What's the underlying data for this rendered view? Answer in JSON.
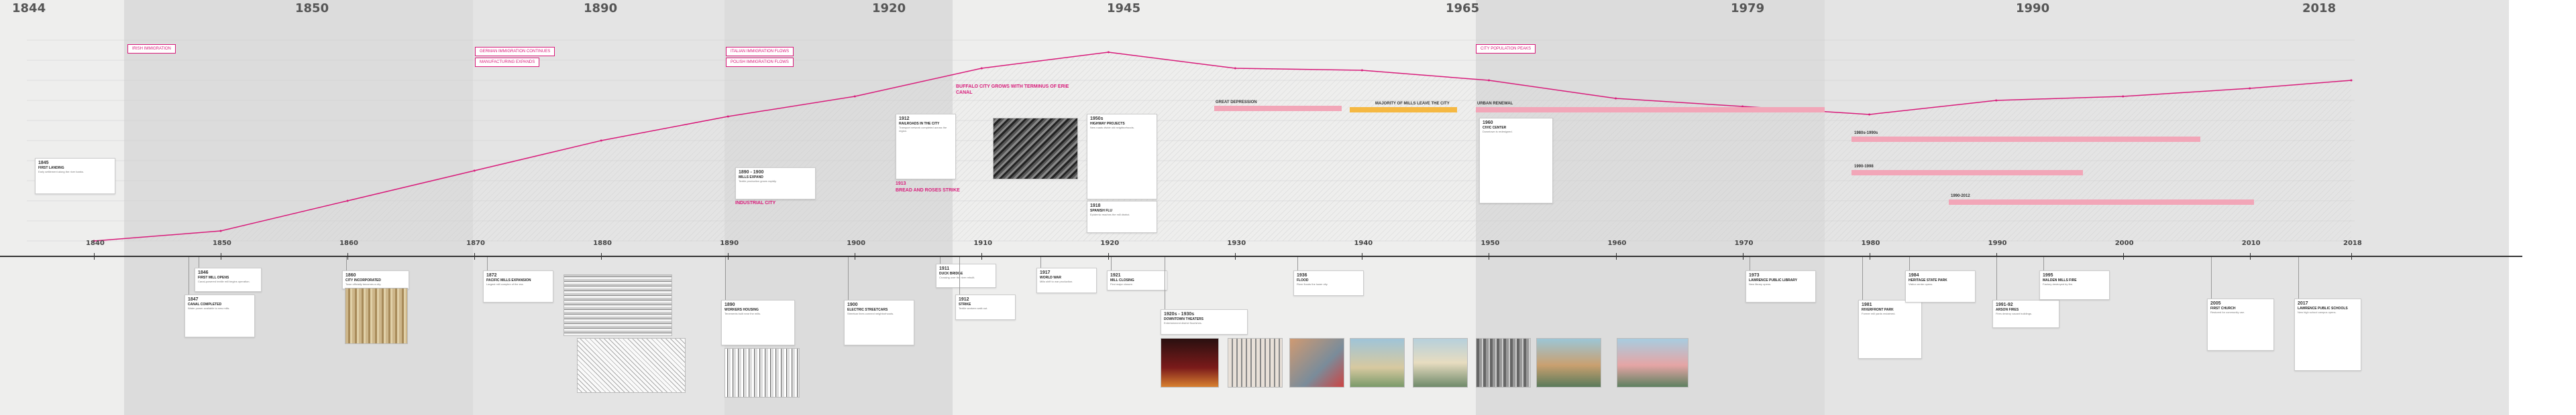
{
  "top_years": [
    "1844",
    "1850",
    "1890",
    "1920",
    "1945",
    "1965",
    "1979",
    "1990",
    "2018"
  ],
  "axis_ticks": [
    "1840",
    "1850",
    "1860",
    "1870",
    "1880",
    "1890",
    "1900",
    "1910",
    "1920",
    "1930",
    "1940",
    "1950",
    "1960",
    "1970",
    "1980",
    "1990",
    "2000",
    "2010",
    "2018"
  ],
  "pink_tags": [
    "IRISH IMMIGRATION",
    "GERMAN IMMIGRATION CONTINUES",
    "MANUFACTURING EXPANDS",
    "ITALIAN IMMIGRATION FLOWS",
    "POLISH IMMIGRATION FLOWS",
    "CITY POPULATION PEAKS",
    "FACTORIES CLOSING"
  ],
  "pink_texts": [
    "BUFFALO CITY GROWS WITH TERMINUS OF ERIE CANAL",
    "BUFFALO BECOMES GREAT INDUSTRIAL CITY",
    "1913",
    "BREAD AND ROSES STRIKE"
  ],
  "bars": [
    {
      "label": "GREAT DEPRESSION",
      "color": "#f2a6b8"
    },
    {
      "label": "MAJORITY OF MILLS LEAVE THE CITY",
      "color": "#f5b842"
    },
    {
      "label": "URBAN RENEWAL",
      "color": "#f2a6b8"
    },
    {
      "label": "1980s-1990s",
      "color": "#f2a6b8"
    },
    {
      "label": "1990-1998",
      "color": "#f2a6b8"
    },
    {
      "label": "1990-2012",
      "color": "#f2a6b8"
    }
  ],
  "upper_cards": [
    {
      "yr": "1845",
      "ttl": "FIRST LANDING",
      "body": "Early settlement along the river banks."
    },
    {
      "yr": "1890 - 1900",
      "ttl": "MILLS EXPAND",
      "body": "Textile production grows rapidly."
    },
    {
      "yr": "1912",
      "ttl": "RAILROADS IN THE CITY",
      "body": "Transport network completed across the region."
    },
    {
      "yr": "1918",
      "ttl": "SPANISH FLU",
      "body": "Epidemic reaches the mill district."
    },
    {
      "yr": "1950s",
      "ttl": "HIGHWAY PROJECTS",
      "body": "New roads divide old neighborhoods."
    },
    {
      "yr": "1960",
      "ttl": "CIVIC CENTER",
      "body": "Downtown is redesigned."
    }
  ],
  "lower_cards": [
    {
      "yr": "1846",
      "ttl": "FIRST MILL OPENS",
      "body": "Canal-powered textile mill begins operation."
    },
    {
      "yr": "1847",
      "ttl": "CANAL COMPLETED",
      "body": "Water power available to new mills."
    },
    {
      "yr": "1860",
      "ttl": "CITY INCORPORATED",
      "body": "Town officially becomes a city."
    },
    {
      "yr": "1872",
      "ttl": "PACIFIC MILLS EXPANSION",
      "body": "Largest mill complex of the era."
    },
    {
      "yr": "1890",
      "ttl": "WORKERS HOUSING",
      "body": "Tenements built near the mills."
    },
    {
      "yr": "1900",
      "ttl": "ELECTRIC STREETCARS",
      "body": "Streetcar lines connect neighborhoods."
    },
    {
      "yr": "1911",
      "ttl": "DUCK BRIDGE",
      "body": "Crossing over the river rebuilt."
    },
    {
      "yr": "1912",
      "ttl": "STRIKE",
      "body": "Textile workers walk out."
    },
    {
      "yr": "1917",
      "ttl": "WORLD WAR",
      "body": "Mills shift to war production."
    },
    {
      "yr": "1921",
      "ttl": "MILL CLOSING",
      "body": "First major closure."
    },
    {
      "yr": "1920s - 1930s",
      "ttl": "DOWNTOWN THEATERS",
      "body": "Entertainment district flourishes."
    },
    {
      "yr": "1936",
      "ttl": "FLOOD",
      "body": "River floods the lower city."
    },
    {
      "yr": "1973",
      "ttl": "LAWRENCE PUBLIC LIBRARY",
      "body": "New library opens."
    },
    {
      "yr": "1981",
      "ttl": "RIVERFRONT PARK",
      "body": "Former mill yards reclaimed."
    },
    {
      "yr": "1984",
      "ttl": "HERITAGE STATE PARK",
      "body": "Visitor center opens."
    },
    {
      "yr": "1991-92",
      "ttl": "ARSON FIRES",
      "body": "Fires destroy vacant buildings."
    },
    {
      "yr": "1995",
      "ttl": "MALDEN MILLS FIRE",
      "body": "Factory destroyed by fire."
    },
    {
      "yr": "2005",
      "ttl": "FIRST CHURCH",
      "body": "Restored for community use."
    },
    {
      "yr": "2017",
      "ttl": "LAWRENCE PUBLIC SCHOOLS",
      "body": "New high school campus opens."
    }
  ],
  "chart_data": {
    "type": "line",
    "title": "",
    "xlabel": "",
    "ylabel": "",
    "x": [
      1840,
      1850,
      1860,
      1870,
      1880,
      1890,
      1900,
      1910,
      1920,
      1930,
      1940,
      1950,
      1960,
      1970,
      1980,
      1990,
      2000,
      2010,
      2018
    ],
    "series": [
      {
        "name": "",
        "values": [
          0,
          5000,
          20000,
          35000,
          50000,
          62000,
          72000,
          86000,
          94000,
          86000,
          85000,
          80000,
          71000,
          67000,
          63000,
          70000,
          72000,
          76000,
          80000
        ]
      }
    ],
    "ylim": [
      0,
      100000
    ],
    "grid": true,
    "color": "#d81b7a"
  }
}
